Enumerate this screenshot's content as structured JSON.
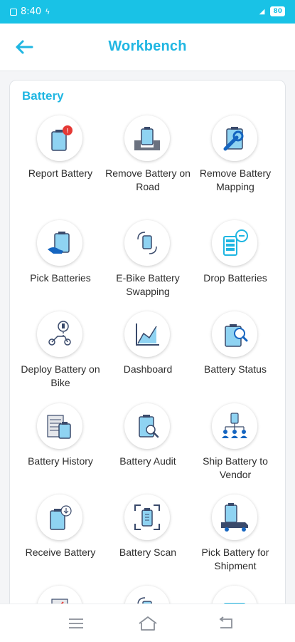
{
  "status_bar": {
    "time": "8:40",
    "battery": "80"
  },
  "app_bar": {
    "title": "Workbench",
    "back_icon": "arrow-left-icon"
  },
  "section": {
    "title": "Battery"
  },
  "colors": {
    "accent": "#1fb6e2",
    "status_bar": "#19c2e6",
    "icon_fill": "#8fd3f2",
    "icon_stroke": "#3a4a6b",
    "alert": "#e53935"
  },
  "tiles": [
    {
      "label": "Report Battery",
      "icon": "battery-alert-icon"
    },
    {
      "label": "Remove Battery on Road",
      "icon": "battery-road-icon"
    },
    {
      "label": "Remove Battery Mapping",
      "icon": "battery-wrench-icon"
    },
    {
      "label": "Pick Batteries",
      "icon": "battery-hand-icon"
    },
    {
      "label": "E-Bike Battery Swapping",
      "icon": "battery-swap-icon"
    },
    {
      "label": "Drop Batteries",
      "icon": "battery-drop-icon"
    },
    {
      "label": "Deploy Battery on Bike",
      "icon": "bike-deploy-icon"
    },
    {
      "label": "Dashboard",
      "icon": "chart-icon"
    },
    {
      "label": "Battery Status",
      "icon": "battery-status-icon"
    },
    {
      "label": "Battery History",
      "icon": "battery-history-icon"
    },
    {
      "label": "Battery Audit",
      "icon": "battery-audit-icon"
    },
    {
      "label": "Ship Battery to Vendor",
      "icon": "battery-ship-icon"
    },
    {
      "label": "Receive Battery",
      "icon": "battery-receive-icon"
    },
    {
      "label": "Battery Scan",
      "icon": "battery-scan-icon"
    },
    {
      "label": "Pick Battery for Shipment",
      "icon": "battery-truck-icon"
    }
  ],
  "nav": {
    "menu": "menu-icon",
    "home": "home-icon",
    "back": "back-icon"
  }
}
